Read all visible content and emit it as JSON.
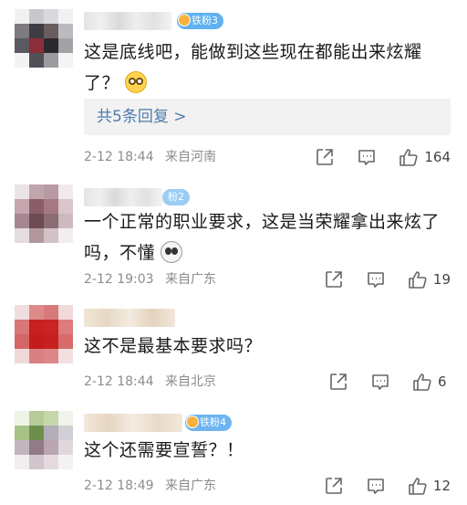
{
  "comments": [
    {
      "badge": "铁粉3",
      "text_line1": "这是底线吧，能做到这些现在都能出来炫耀",
      "text_line2": "了？",
      "replies_label": "共5条回复 >",
      "date": "2-12 18:44",
      "location": "来自河南",
      "likes": "164",
      "emoji": "glasses-face-emoji"
    },
    {
      "badge": "粉2",
      "text_line1": "一个正常的职业要求，这是当荣耀拿出来炫了",
      "text_line2": "吗，不懂",
      "date": "2-12 19:03",
      "location": "来自广东",
      "likes": "19",
      "emoji": "panda-face-emoji"
    },
    {
      "text_line1": "这不是最基本要求吗？",
      "date": "2-12 18:44",
      "location": "来自北京",
      "likes": "6"
    },
    {
      "badge": "铁粉4",
      "text_line1": "这个还需要宣誓？！",
      "date": "2-12 18:49",
      "location": "来自广东",
      "likes": "12"
    }
  ],
  "icons": {
    "share": "share-icon",
    "comment": "comment-icon",
    "like": "thumbs-up-icon"
  }
}
